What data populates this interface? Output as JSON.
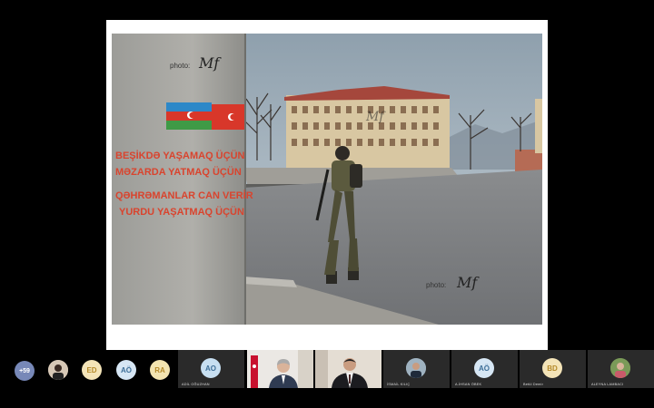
{
  "slide": {
    "watermark_top": "photo: ",
    "watermark_bottom": "photo: ",
    "wall_text": [
      "BEŞİKDƏ YAŞAMAQ ÜÇÜN",
      "MƏZARDA YATMAQ ÜÇÜN",
      "QƏHRƏMANLAR CAN VERİR",
      "YURDU YAŞATMAQ ÜÇÜN"
    ]
  },
  "participants": {
    "overflow_count": "+59",
    "tiles": [
      {
        "initials": "ED",
        "color": "#f4e4b8"
      },
      {
        "initials": "AÖ",
        "color": "#d6e6f4"
      },
      {
        "initials": "RA",
        "color": "#f3e4b0"
      },
      {
        "initials": "AO",
        "color": "#c7dff1",
        "name": "ADİL OĞUZHAN"
      },
      {
        "initials": "",
        "name": "İSMAİL KILIÇ"
      },
      {
        "initials": "AÖ",
        "color": "#d6e6f4",
        "name": "A.İHSAN ÖBEK"
      },
      {
        "initials": "BD",
        "color": "#f4e4b8",
        "name": "Betül Demir"
      },
      {
        "initials": "",
        "name": "ALEYNA LAMBACI"
      }
    ]
  }
}
